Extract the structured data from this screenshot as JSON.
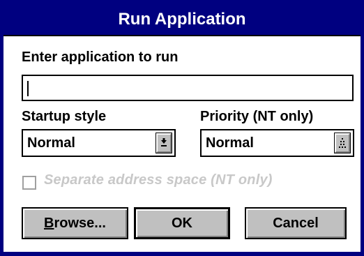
{
  "window": {
    "title": "Run Application"
  },
  "application": {
    "label": "Enter application to run",
    "value": ""
  },
  "startup": {
    "label": "Startup style",
    "selected": "Normal"
  },
  "priority": {
    "label": "Priority (NT only)",
    "selected": "Normal"
  },
  "separate_address": {
    "label": "Separate address space (NT only)",
    "checked": false,
    "enabled": false
  },
  "buttons": {
    "browse_mnemonic": "B",
    "browse_rest": "rowse...",
    "ok": "OK",
    "cancel": "Cancel"
  },
  "colors": {
    "titlebar": "#000080",
    "face": "#c0c0c0",
    "disabled_text": "#c8c8c8"
  },
  "icons": {
    "startup_dropdown": "dropdown-arrow-icon",
    "priority_dropdown": "spinner-dots-icon"
  }
}
